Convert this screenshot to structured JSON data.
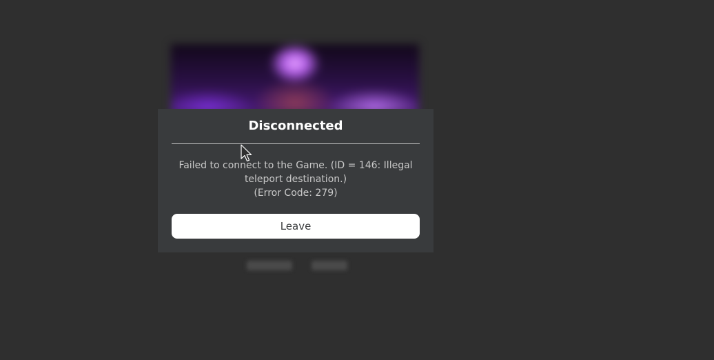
{
  "background": {
    "color": "#2f2f2f"
  },
  "dialog": {
    "title": "Disconnected",
    "message_line1": "Failed to connect to the Game. (ID = 146: Illegal teleport destination.)",
    "message_line2": "(Error Code: 279)",
    "button_label": "Leave",
    "background_color": "#393b3d",
    "button_color": "#ffffff"
  },
  "cursor": {
    "icon": "arrow-pointer-icon"
  }
}
